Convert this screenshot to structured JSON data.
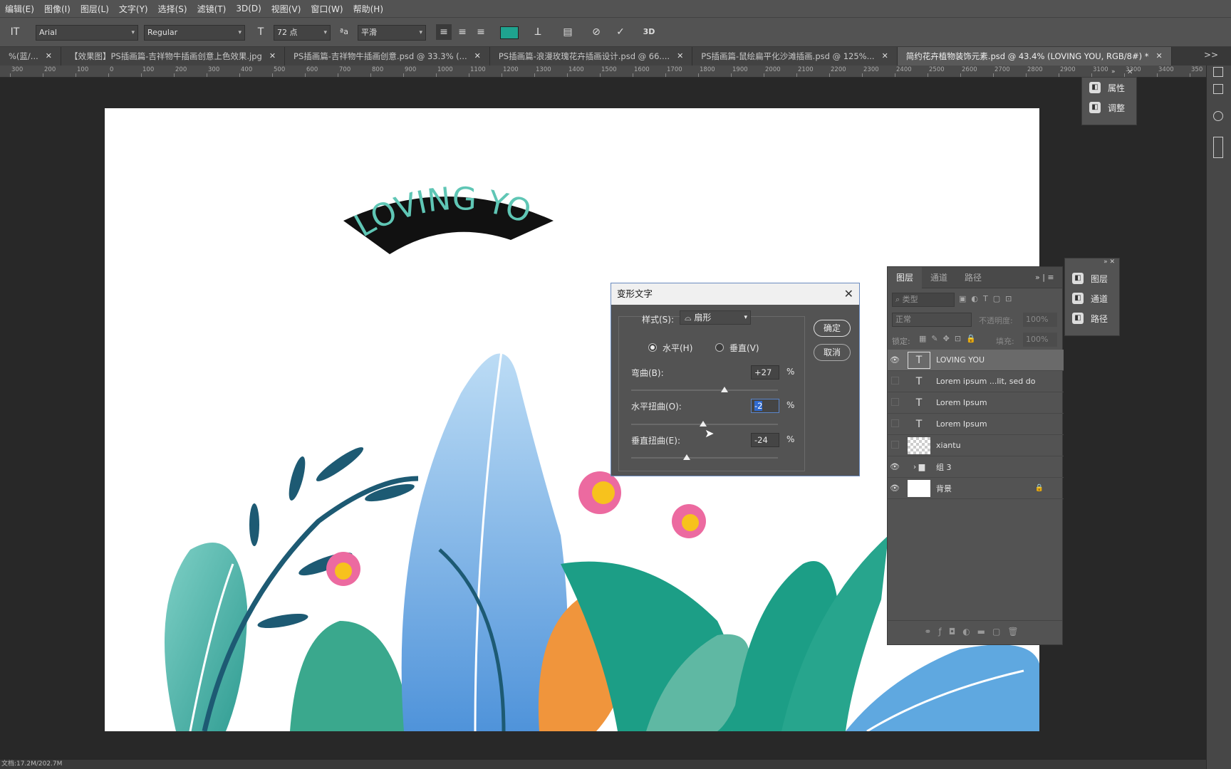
{
  "menu": [
    "编辑(E)",
    "图像(I)",
    "图层(L)",
    "文字(Y)",
    "选择(S)",
    "滤镜(T)",
    "3D(D)",
    "视图(V)",
    "窗口(W)",
    "帮助(H)"
  ],
  "options": {
    "font": "Arial",
    "style": "Regular",
    "size": "72 点",
    "aa_label": "a a",
    "antialias": "平滑",
    "color": "#1fa38f"
  },
  "tabs": [
    {
      "label": "%(蓝/...",
      "active": false
    },
    {
      "label": "【效果图】PS插画篇-吉祥物牛插画创意上色效果.jpg",
      "active": false
    },
    {
      "label": "PS插画篇-吉祥物牛插画创意.psd @ 33.3% (...",
      "active": false
    },
    {
      "label": "PS插画篇-浪漫玫瑰花卉插画设计.psd @ 66....",
      "active": false
    },
    {
      "label": "PS插画篇-鼠绘扁平化沙滩插画.psd @ 125%...",
      "active": false
    },
    {
      "label": "简约花卉植物装饰元素.psd @ 43.4% (LOVING YOU, RGB/8#) *",
      "active": true
    }
  ],
  "tab_overflow": ">>",
  "ruler_ticks": [
    "300",
    "200",
    "100",
    "0",
    "100",
    "200",
    "300",
    "400",
    "500",
    "600",
    "700",
    "800",
    "900",
    "1000",
    "1100",
    "1200",
    "1300",
    "1400",
    "1500",
    "1600",
    "1700",
    "1800",
    "1900",
    "2000",
    "2100",
    "2200",
    "2300",
    "2400",
    "2500",
    "2600",
    "2700",
    "2800",
    "2900",
    "3100",
    "3300",
    "3400",
    "350"
  ],
  "canvas_text": "LOVING YOU",
  "right_panel_a": [
    {
      "label": "属性",
      "icon": "properties-icon"
    },
    {
      "label": "调整",
      "icon": "adjustments-icon"
    }
  ],
  "right_panel_b": [
    {
      "label": "图层",
      "icon": "layers-icon"
    },
    {
      "label": "通道",
      "icon": "channels-icon"
    },
    {
      "label": "路径",
      "icon": "paths-icon"
    }
  ],
  "layers_panel": {
    "tabs": [
      "图层",
      "通道",
      "路径"
    ],
    "filter_placeholder": "类型",
    "blend": "正常",
    "opacity_label": "不透明度:",
    "opacity": "100%",
    "lock_label": "锁定:",
    "fill_label": "填充:",
    "fill": "100%",
    "layers": [
      {
        "name": "LOVING YOU",
        "kind": "T",
        "visible": true,
        "selected": true
      },
      {
        "name": "Lorem ipsum ...lit, sed do",
        "kind": "T",
        "visible": false,
        "selected": false
      },
      {
        "name": "Lorem Ipsum",
        "kind": "T",
        "visible": false,
        "selected": false
      },
      {
        "name": "Lorem Ipsum",
        "kind": "T",
        "visible": false,
        "selected": false
      },
      {
        "name": "xiantu",
        "kind": "img",
        "visible": false,
        "selected": false
      },
      {
        "name": "组 3",
        "kind": "folder",
        "visible": true,
        "selected": false
      },
      {
        "name": "背景",
        "kind": "bg",
        "visible": true,
        "selected": false
      }
    ]
  },
  "dialog": {
    "title": "变形文字",
    "style_label": "样式(S):",
    "style_value": "扇形",
    "horizontal": "水平(H)",
    "vertical": "垂直(V)",
    "bend_label": "弯曲(B):",
    "bend": "+27",
    "hdist_label": "水平扭曲(O):",
    "hdist": "-2",
    "vdist_label": "垂直扭曲(E):",
    "vdist": "-24",
    "pct": "%",
    "ok": "确定",
    "cancel": "取消",
    "bend_value": 27,
    "hdist_value": -2,
    "vdist_value": -24
  },
  "status": "文档:17.2M/202.7M"
}
